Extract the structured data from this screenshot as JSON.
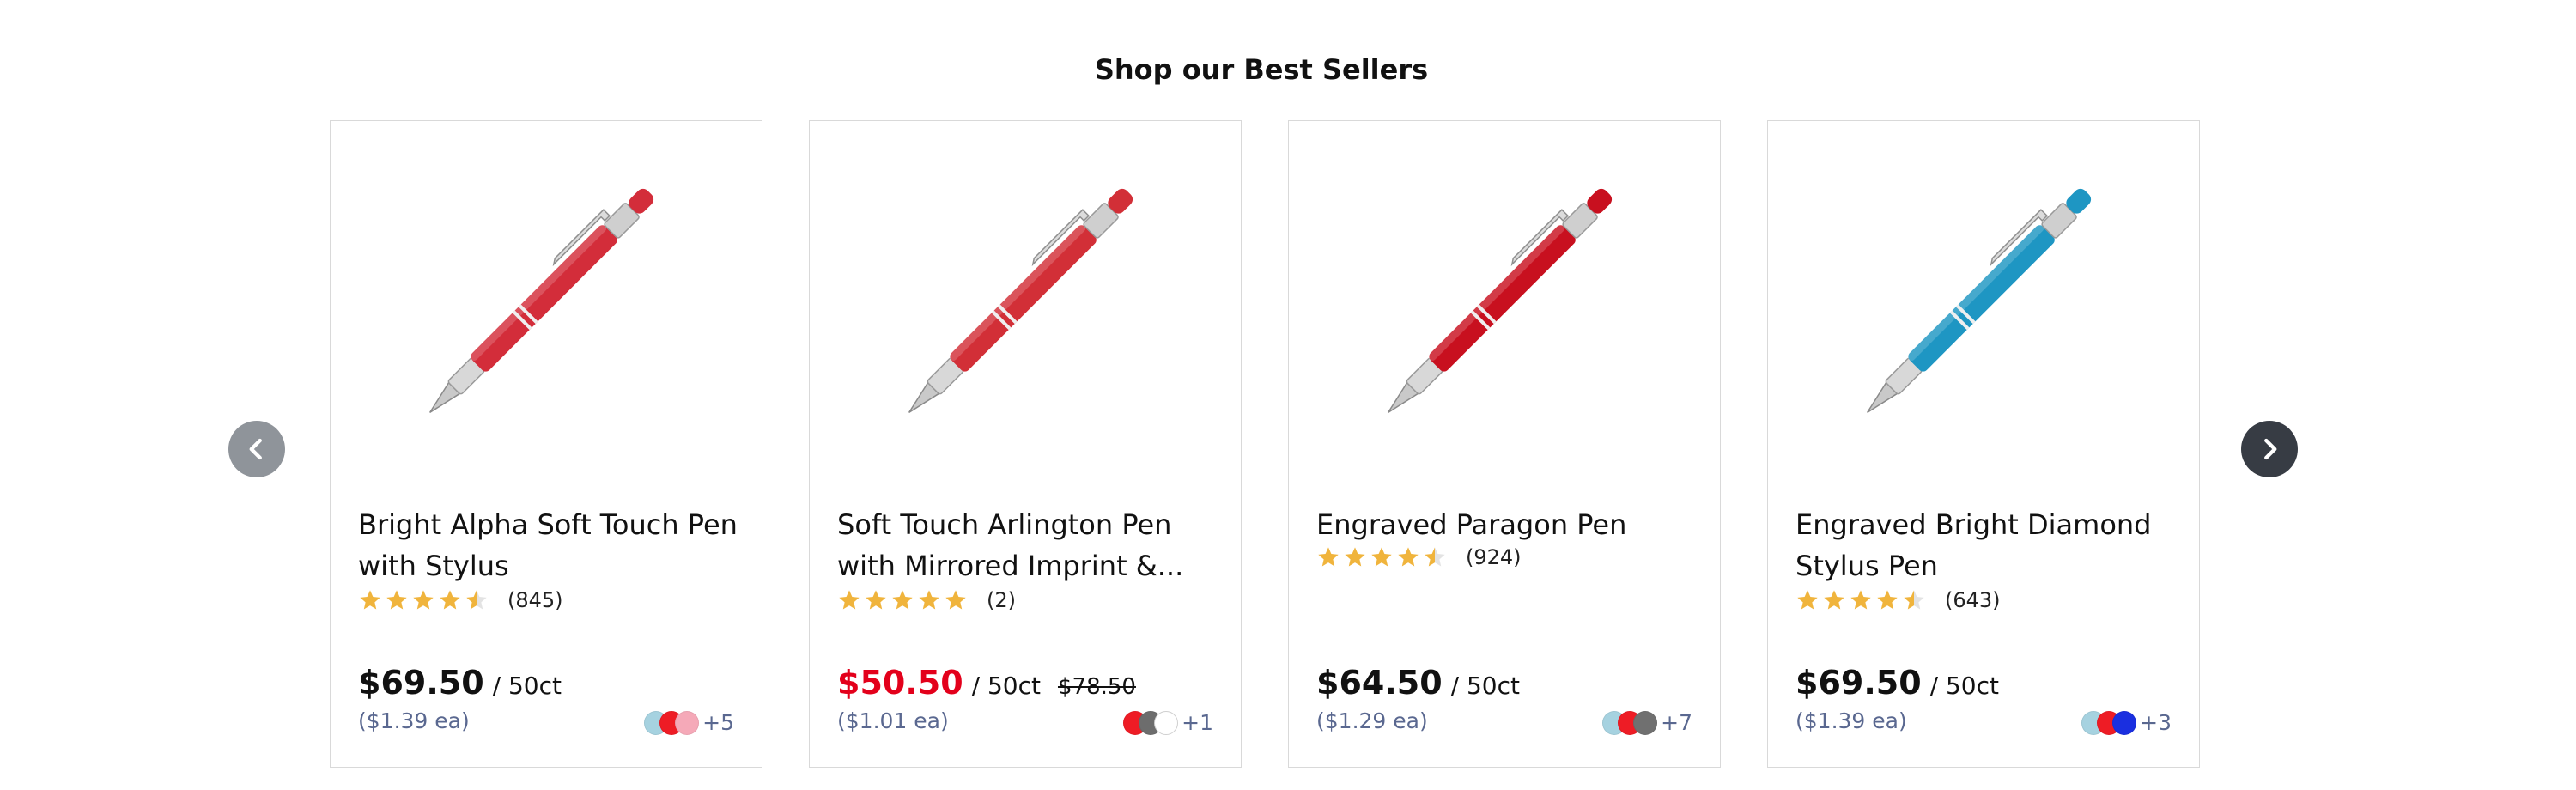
{
  "section": {
    "title": "Shop our Best Sellers"
  },
  "nav": {
    "prev_icon": "chevron-left-icon",
    "next_icon": "chevron-right-icon"
  },
  "colors": {
    "star": "#f0b43c",
    "star_empty": "#e3e3e3",
    "sale_price": "#e3001b",
    "per_each": "#5a6890",
    "arrow_prev_bg": "#8f949a",
    "arrow_next_bg": "#373c44"
  },
  "products": [
    {
      "name": "Bright Alpha Soft Touch Pen with Stylus",
      "image_icon": "red-stylus-pen-icon",
      "pen_color": "#d32d3a",
      "rating": 4.5,
      "rating_count": "(845)",
      "price": "$69.50",
      "qty": "/ 50ct",
      "original_price": "",
      "per_each": "($1.39 ea)",
      "swatches": [
        "#a6d2e0",
        "#ee1c25",
        "#f5a9b8"
      ],
      "more_colors": "+5"
    },
    {
      "name": "Soft Touch Arlington Pen with Mirrored Imprint &...",
      "image_icon": "red-pen-icon",
      "pen_color": "#d22f37",
      "rating": 5,
      "rating_count": "(2)",
      "price": "$50.50",
      "qty": "/ 50ct",
      "original_price": "$78.50",
      "per_each": "($1.01 ea)",
      "swatches": [
        "#ee1c25",
        "#6d6d6d",
        "#ffffff"
      ],
      "more_colors": "+1"
    },
    {
      "name": "Engraved Paragon Pen",
      "image_icon": "red-metal-pen-icon",
      "pen_color": "#c8101f",
      "rating": 4.5,
      "rating_count": "(924)",
      "price": "$64.50",
      "qty": "/ 50ct",
      "original_price": "",
      "per_each": "($1.29 ea)",
      "swatches": [
        "#a6d2e0",
        "#ee1c25",
        "#707070"
      ],
      "more_colors": "+7"
    },
    {
      "name": "Engraved Bright Diamond Stylus Pen",
      "image_icon": "blue-stylus-pen-icon",
      "pen_color": "#1e96c3",
      "rating": 4.5,
      "rating_count": "(643)",
      "price": "$69.50",
      "qty": "/ 50ct",
      "original_price": "",
      "per_each": "($1.39 ea)",
      "swatches": [
        "#a6d2e0",
        "#ee1c25",
        "#1a2fe0"
      ],
      "more_colors": "+3"
    }
  ]
}
